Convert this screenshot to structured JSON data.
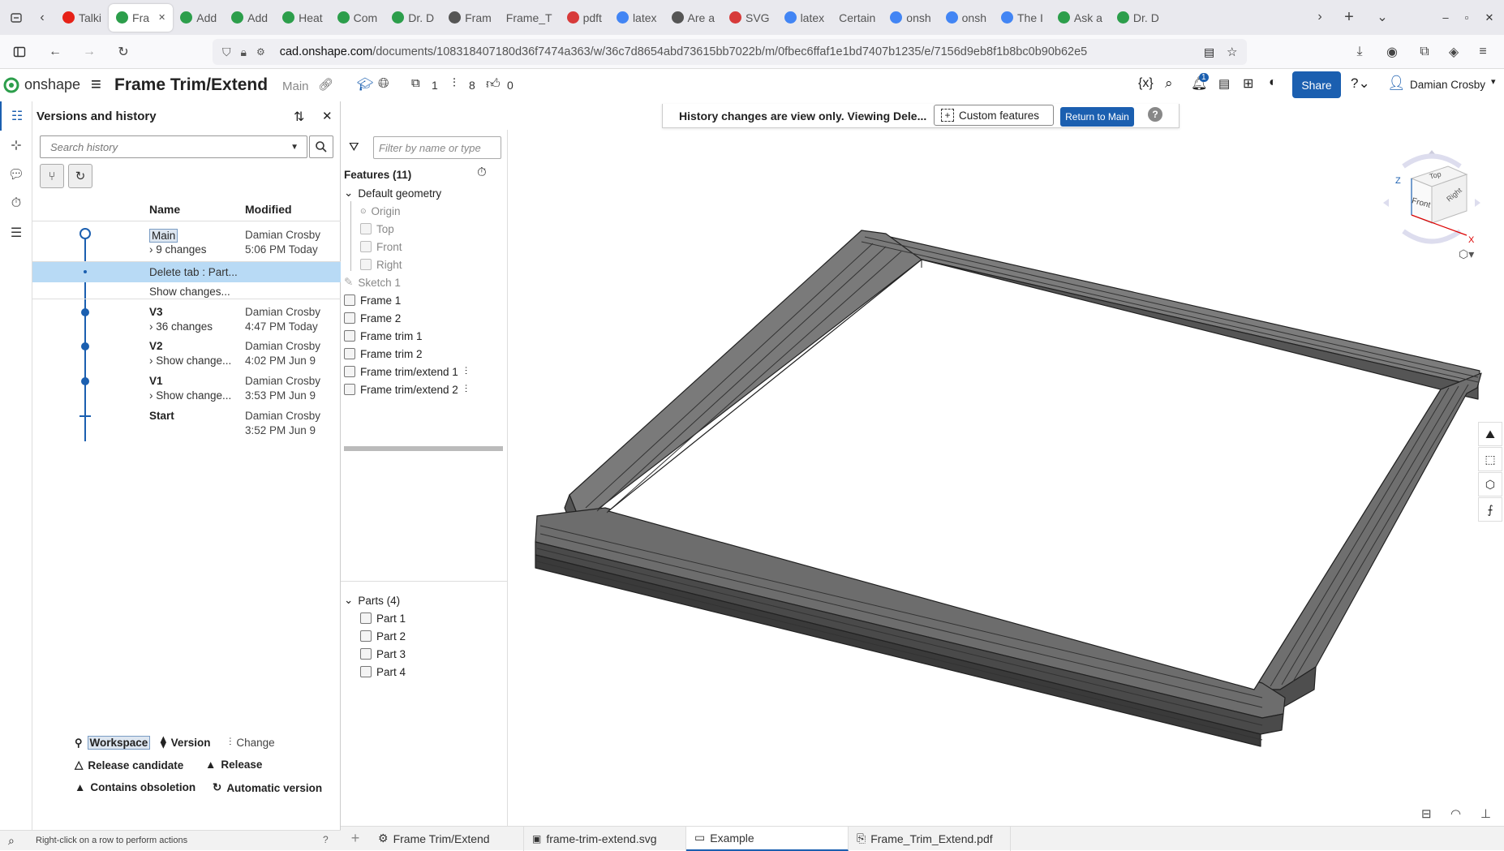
{
  "browser": {
    "tabs": [
      {
        "label": "Talki",
        "color": "#e62117"
      },
      {
        "label": "Fra",
        "color": "#2c9e4b",
        "active": true
      },
      {
        "label": "Add",
        "color": "#2c9e4b"
      },
      {
        "label": "Add",
        "color": "#2c9e4b"
      },
      {
        "label": "Heat",
        "color": "#2c9e4b"
      },
      {
        "label": "Com",
        "color": "#2c9e4b"
      },
      {
        "label": "Dr. D",
        "color": "#2c9e4b"
      },
      {
        "label": "Fram",
        "color": "#555555"
      },
      {
        "label": "Frame_T",
        "color": ""
      },
      {
        "label": "pdft",
        "color": "#d73a3a"
      },
      {
        "label": "latex",
        "color": "#4285f4"
      },
      {
        "label": "Are a",
        "color": "#555555"
      },
      {
        "label": "SVG",
        "color": "#d73a3a"
      },
      {
        "label": "latex",
        "color": "#4285f4"
      },
      {
        "label": "Certain",
        "color": ""
      },
      {
        "label": "onsh",
        "color": "#4285f4"
      },
      {
        "label": "onsh",
        "color": "#4285f4"
      },
      {
        "label": "The I",
        "color": "#4285f4"
      },
      {
        "label": "Ask a",
        "color": "#2c9e4b"
      },
      {
        "label": "Dr. D",
        "color": "#2c9e4b"
      }
    ],
    "url_domain": "cad.onshape.com",
    "url_path": "/documents/108318407180d36f7474a363/w/36c7d8654abd73615bb7022b/m/0fbec6ffaf1e1bd7407b1235/e/7156d9eb8f1b8bc0b90b62e5"
  },
  "app": {
    "logo": "onshape",
    "doc_title": "Frame Trim/Extend",
    "branch": "Main",
    "counts": {
      "parts": "1",
      "versions": "8",
      "likes": "0"
    },
    "notifications": "1",
    "share_label": "Share",
    "user": "Damian Crosby"
  },
  "versions": {
    "title": "Versions and history",
    "search_placeholder": "Search history",
    "col_name": "Name",
    "col_modified": "Modified",
    "rows": [
      {
        "name": "Main",
        "sub": "9 changes",
        "by": "Damian Crosby",
        "time": "5:06 PM Today"
      },
      {
        "name": "Delete tab : Part...",
        "sub": "Show changes...",
        "by": "",
        "time": ""
      },
      {
        "name": "V3",
        "sub": "36 changes",
        "by": "Damian Crosby",
        "time": "4:47 PM Today"
      },
      {
        "name": "V2",
        "sub": "Show change...",
        "by": "Damian Crosby",
        "time": "4:02 PM Jun 9"
      },
      {
        "name": "V1",
        "sub": "Show change...",
        "by": "Damian Crosby",
        "time": "3:53 PM Jun 9"
      },
      {
        "name": "Start",
        "sub": "",
        "by": "Damian Crosby",
        "time": "3:52 PM Jun 9"
      }
    ],
    "legend": {
      "workspace": "Workspace",
      "version": "Version",
      "change": "Change",
      "release_candidate": "Release candidate",
      "release": "Release",
      "obsolete": "Contains obsoletion",
      "auto": "Automatic version"
    },
    "status": "Right-click on a row to perform actions"
  },
  "features": {
    "filter_placeholder": "Filter by name or type",
    "header": "Features (11)",
    "default_geometry": "Default geometry",
    "items": [
      "Origin",
      "Top",
      "Front",
      "Right",
      "Sketch 1",
      "Frame 1",
      "Frame 2",
      "Frame trim 1",
      "Frame trim 2",
      "Frame trim/extend 1",
      "Frame trim/extend 2"
    ],
    "parts_header": "Parts (4)",
    "parts": [
      "Part 1",
      "Part 2",
      "Part 3",
      "Part 4"
    ]
  },
  "banner": {
    "text": "History changes are view only. Viewing Dele...",
    "custom": "Custom features",
    "return": "Return to Main"
  },
  "viewcube": {
    "top": "Top",
    "front": "Front",
    "right": "Right",
    "z": "Z",
    "x": "X"
  },
  "bottom_tabs": [
    "Frame Trim/Extend",
    "frame-trim-extend.svg",
    "Example",
    "Frame_Trim_Extend.pdf"
  ],
  "colors": {
    "accent": "#1b5fb0",
    "selection": "#b8daf5",
    "timeline": "#1b5fb0"
  }
}
